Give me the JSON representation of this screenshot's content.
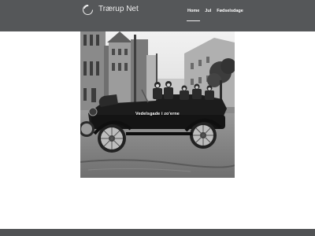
{
  "site": {
    "title": "Trærup Net",
    "logo": "circle-logo-icon"
  },
  "nav": {
    "items": [
      {
        "label": "Home",
        "active": true
      },
      {
        "label": "Jul",
        "active": false
      },
      {
        "label": "Fødselsdage",
        "active": false
      }
    ]
  },
  "hero": {
    "caption": "Vedelsgade i zo'erne",
    "image": "black-and-white-vintage-car-street-photo"
  },
  "colors": {
    "header": "#555759",
    "footer": "#505254",
    "background": "#ffffff"
  }
}
